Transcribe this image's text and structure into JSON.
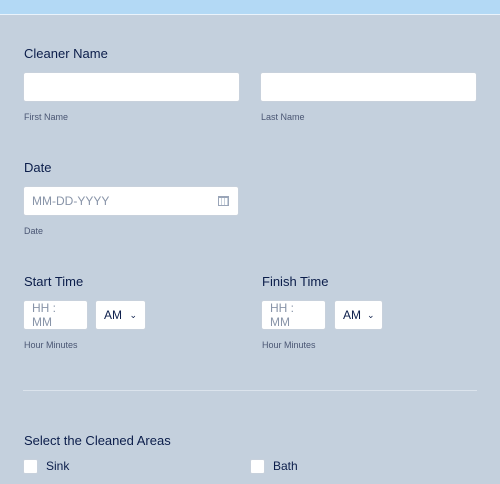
{
  "cleaner": {
    "label": "Cleaner Name",
    "first_sub": "First Name",
    "last_sub": "Last Name"
  },
  "date": {
    "label": "Date",
    "placeholder": "MM-DD-YYYY",
    "sub": "Date"
  },
  "start_time": {
    "label": "Start Time",
    "placeholder": "HH : MM",
    "ampm": "AM",
    "sub": "Hour Minutes"
  },
  "finish_time": {
    "label": "Finish Time",
    "placeholder": "HH : MM",
    "ampm": "AM",
    "sub": "Hour Minutes"
  },
  "areas": {
    "label": "Select the Cleaned Areas",
    "options": [
      "Sink",
      "Bath"
    ]
  },
  "icons": {
    "calendar": "calendar-icon",
    "chevron": "chevron-down-icon"
  },
  "colors": {
    "background": "#c4d0dd",
    "top_bar": "#b3d9f5",
    "text": "#0b1d4a"
  }
}
